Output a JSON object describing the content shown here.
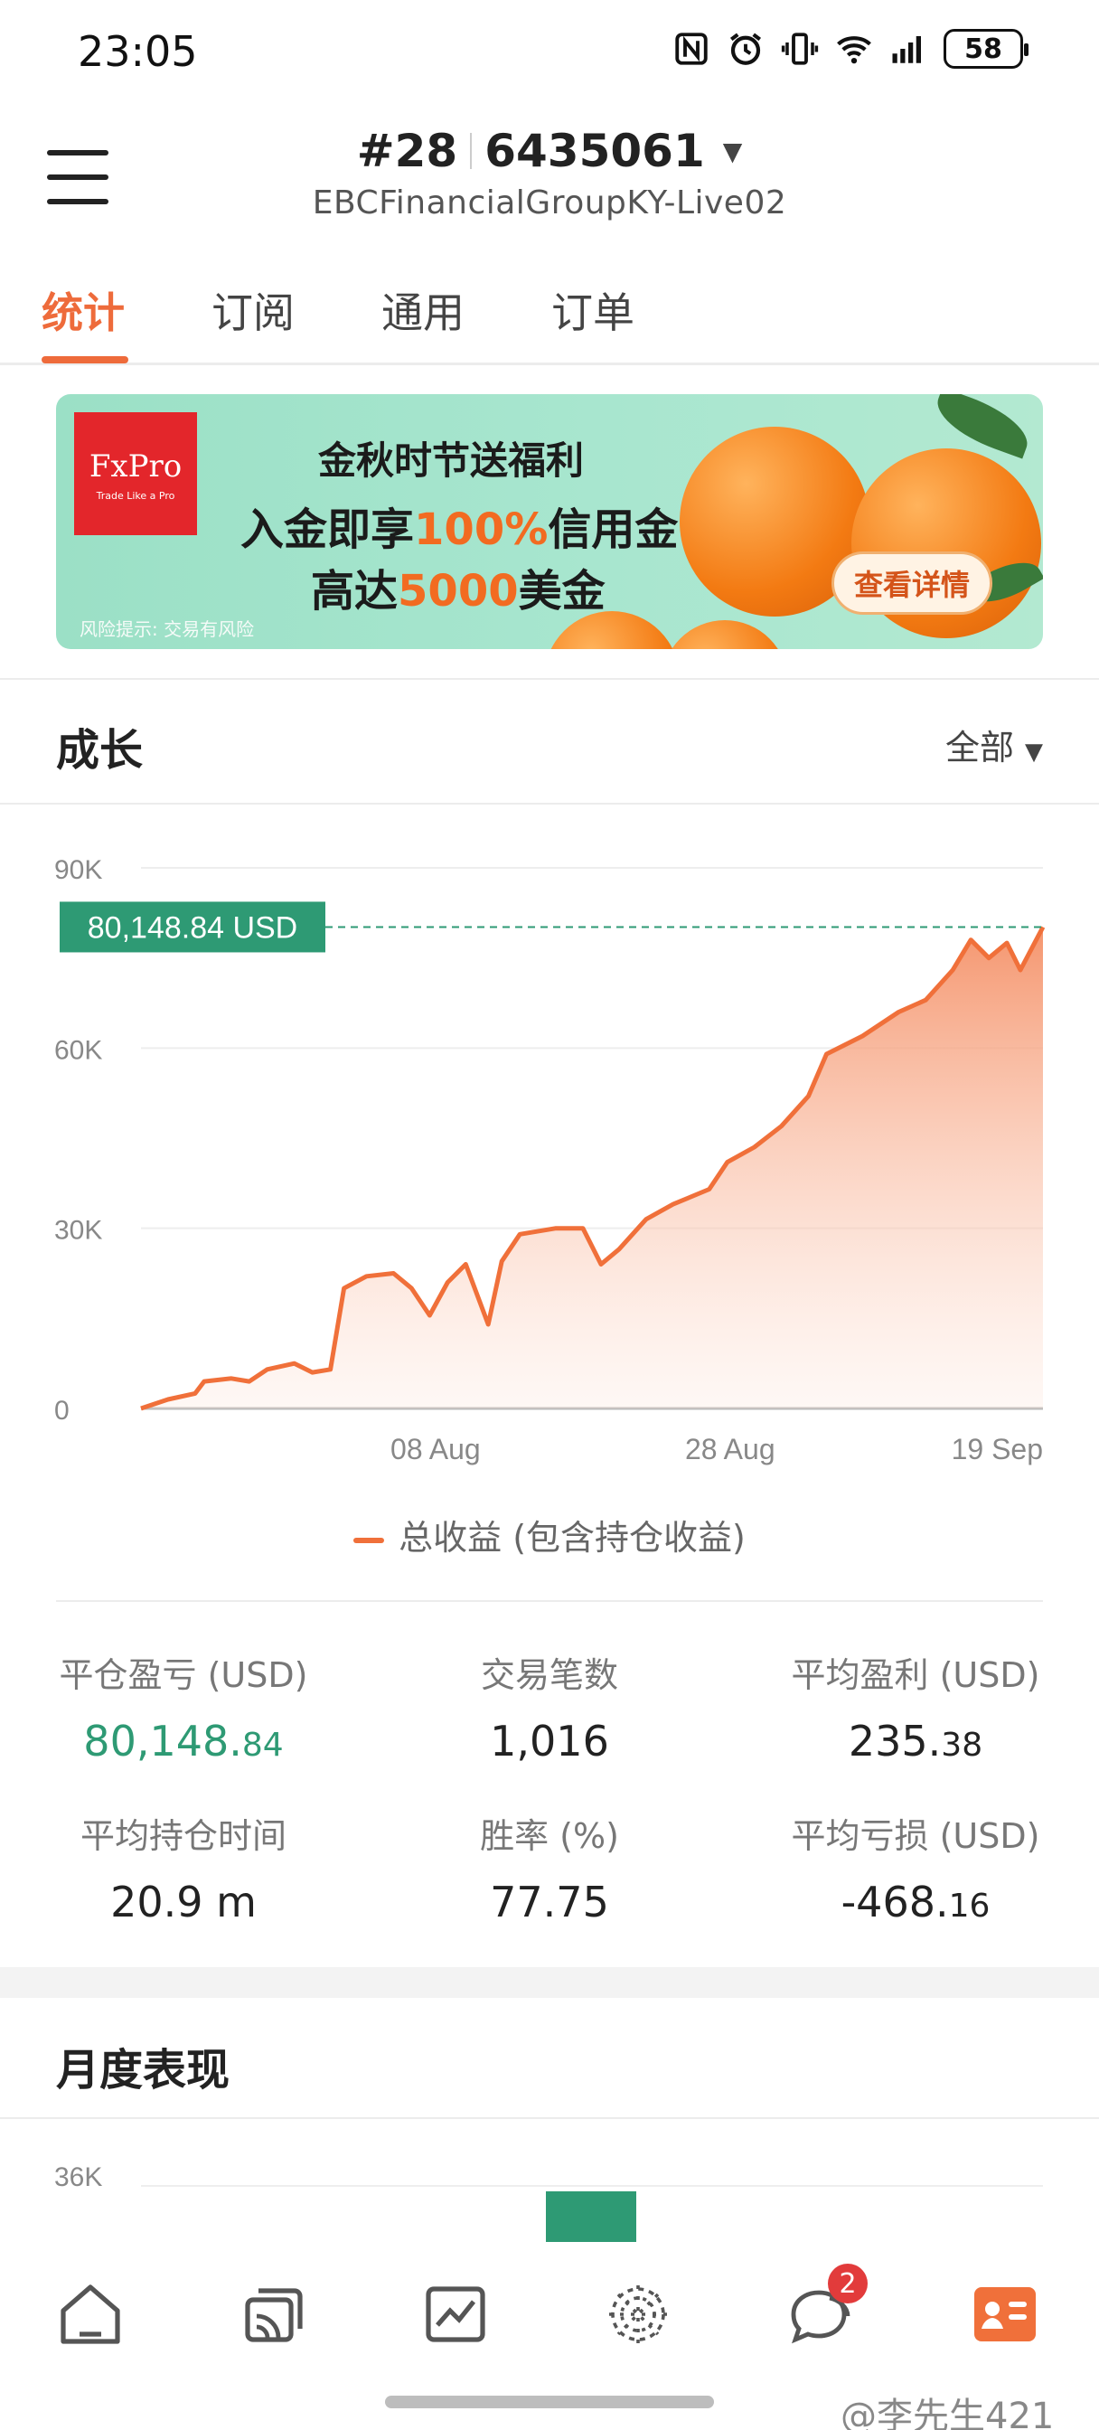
{
  "status_bar": {
    "time": "23:05",
    "battery": "58",
    "icons": [
      "nfc-icon",
      "alarm-icon",
      "vibrate-icon",
      "wifi-icon",
      "signal-icon"
    ]
  },
  "header": {
    "rank": "#28",
    "account_number": "6435061",
    "broker": "EBCFinancialGroupKY-Live02"
  },
  "tabs": [
    "统计",
    "订阅",
    "通用",
    "订单"
  ],
  "banner": {
    "logo_name": "FxPro",
    "logo_tagline": "Trade Like a Pro",
    "line1": "金秋时节送福利",
    "line2_prefix": "入金即享",
    "line2_highlight": "100%",
    "line2_suffix": "信用金",
    "line3_prefix": "高达",
    "line3_highlight": "5000",
    "line3_suffix": "美金",
    "button": "查看详情",
    "risk": "风险提示: 交易有风险"
  },
  "growth": {
    "title": "成长",
    "filter": "全部",
    "legend": "总收益 (包含持仓收益)"
  },
  "chart_data": {
    "type": "area",
    "title": "",
    "current_value_label": "80,148.84 USD",
    "current_value": 80148.84,
    "y_ticks": [
      "90K",
      "60K",
      "30K",
      "0"
    ],
    "y_tick_values": [
      90000,
      60000,
      30000,
      0
    ],
    "ylim": [
      0,
      90000
    ],
    "x_ticks": [
      "08 Aug",
      "28 Aug",
      "19 Sep"
    ],
    "x_tick_values": [
      0.3265,
      0.6531,
      1.0
    ],
    "xlim": [
      0,
      1
    ],
    "color": "#f0703a",
    "series": [
      {
        "name": "总收益 (包含持仓收益)",
        "values": [
          [
            0.0,
            0
          ],
          [
            0.03,
            1500
          ],
          [
            0.06,
            2500
          ],
          [
            0.07,
            4500
          ],
          [
            0.1,
            5000
          ],
          [
            0.12,
            4500
          ],
          [
            0.14,
            6500
          ],
          [
            0.17,
            7500
          ],
          [
            0.19,
            6000
          ],
          [
            0.21,
            6500
          ],
          [
            0.225,
            20000
          ],
          [
            0.25,
            22000
          ],
          [
            0.28,
            22500
          ],
          [
            0.3,
            20000
          ],
          [
            0.32,
            15500
          ],
          [
            0.34,
            21000
          ],
          [
            0.36,
            24000
          ],
          [
            0.385,
            14000
          ],
          [
            0.4,
            24500
          ],
          [
            0.42,
            29000
          ],
          [
            0.46,
            30000
          ],
          [
            0.49,
            30000
          ],
          [
            0.51,
            24000
          ],
          [
            0.53,
            26500
          ],
          [
            0.56,
            31500
          ],
          [
            0.59,
            34000
          ],
          [
            0.63,
            36500
          ],
          [
            0.65,
            41000
          ],
          [
            0.68,
            43500
          ],
          [
            0.71,
            47000
          ],
          [
            0.74,
            52000
          ],
          [
            0.76,
            59000
          ],
          [
            0.8,
            62000
          ],
          [
            0.84,
            66000
          ],
          [
            0.87,
            68000
          ],
          [
            0.9,
            73000
          ],
          [
            0.92,
            78000
          ],
          [
            0.94,
            75000
          ],
          [
            0.96,
            77500
          ],
          [
            0.975,
            73000
          ],
          [
            1.0,
            80148.84
          ]
        ]
      }
    ]
  },
  "stats": [
    {
      "label": "平仓盈亏 (USD)",
      "main": "80,148.",
      "decimals": "84",
      "color": "#2e9a74"
    },
    {
      "label": "交易笔数",
      "main": "1,016",
      "decimals": ""
    },
    {
      "label": "平均盈利 (USD)",
      "main": "235.",
      "decimals": "38"
    },
    {
      "label": "平均持仓时间",
      "main": "20.9 m",
      "decimals": ""
    },
    {
      "label": "胜率 (%)",
      "main": "77.75",
      "decimals": ""
    },
    {
      "label": "平均亏损 (USD)",
      "main": "-468.",
      "decimals": "16"
    }
  ],
  "monthly": {
    "title": "月度表现",
    "y_tick": "36K",
    "bar_color": "#2e9a74"
  },
  "bottom_nav": {
    "items": [
      "home-icon",
      "copy-trading-icon",
      "chart-icon",
      "discover-icon",
      "messages-icon",
      "profile-icon"
    ],
    "badge": "2"
  },
  "watermark": "@李先生421"
}
